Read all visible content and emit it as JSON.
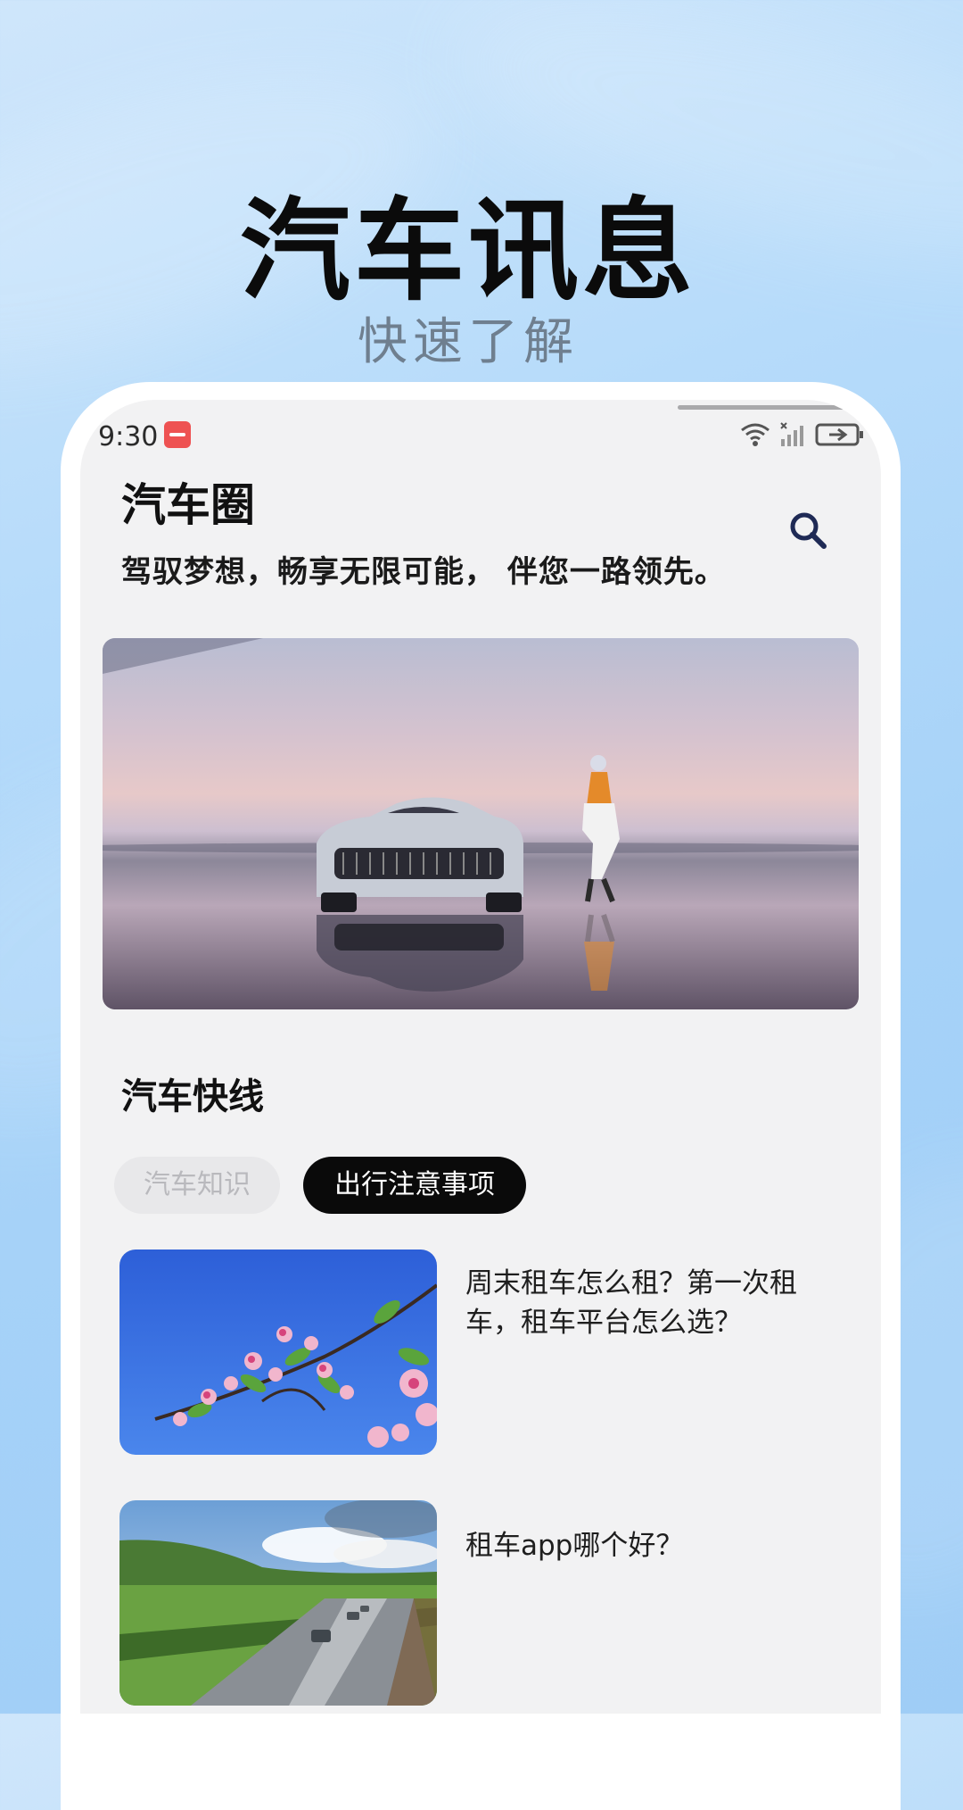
{
  "promo": {
    "title": "汽车讯息",
    "subtitle": "快速了解"
  },
  "status_bar": {
    "time": "9:30",
    "icons": [
      "wifi-icon",
      "signal-icon",
      "battery-icon"
    ]
  },
  "header": {
    "title": "汽车圈",
    "slogan": "驾驭梦想，畅享无限可能， 伴您一路领先。",
    "search_icon": "search-icon"
  },
  "section": {
    "title": "汽车快线"
  },
  "tabs": [
    {
      "label": "汽车知识",
      "active": false
    },
    {
      "label": "出行注意事项",
      "active": true
    }
  ],
  "articles": [
    {
      "title": "周末租车怎么租？第一次租车，租车平台怎么选？"
    },
    {
      "title": "租车app哪个好？"
    }
  ],
  "colors": {
    "accent": "#0a0a0a",
    "background_blue": "#a6d2f8",
    "screen_bg": "#f2f2f3",
    "badge_red": "#ee5252",
    "search_icon": "#1f2a55"
  }
}
